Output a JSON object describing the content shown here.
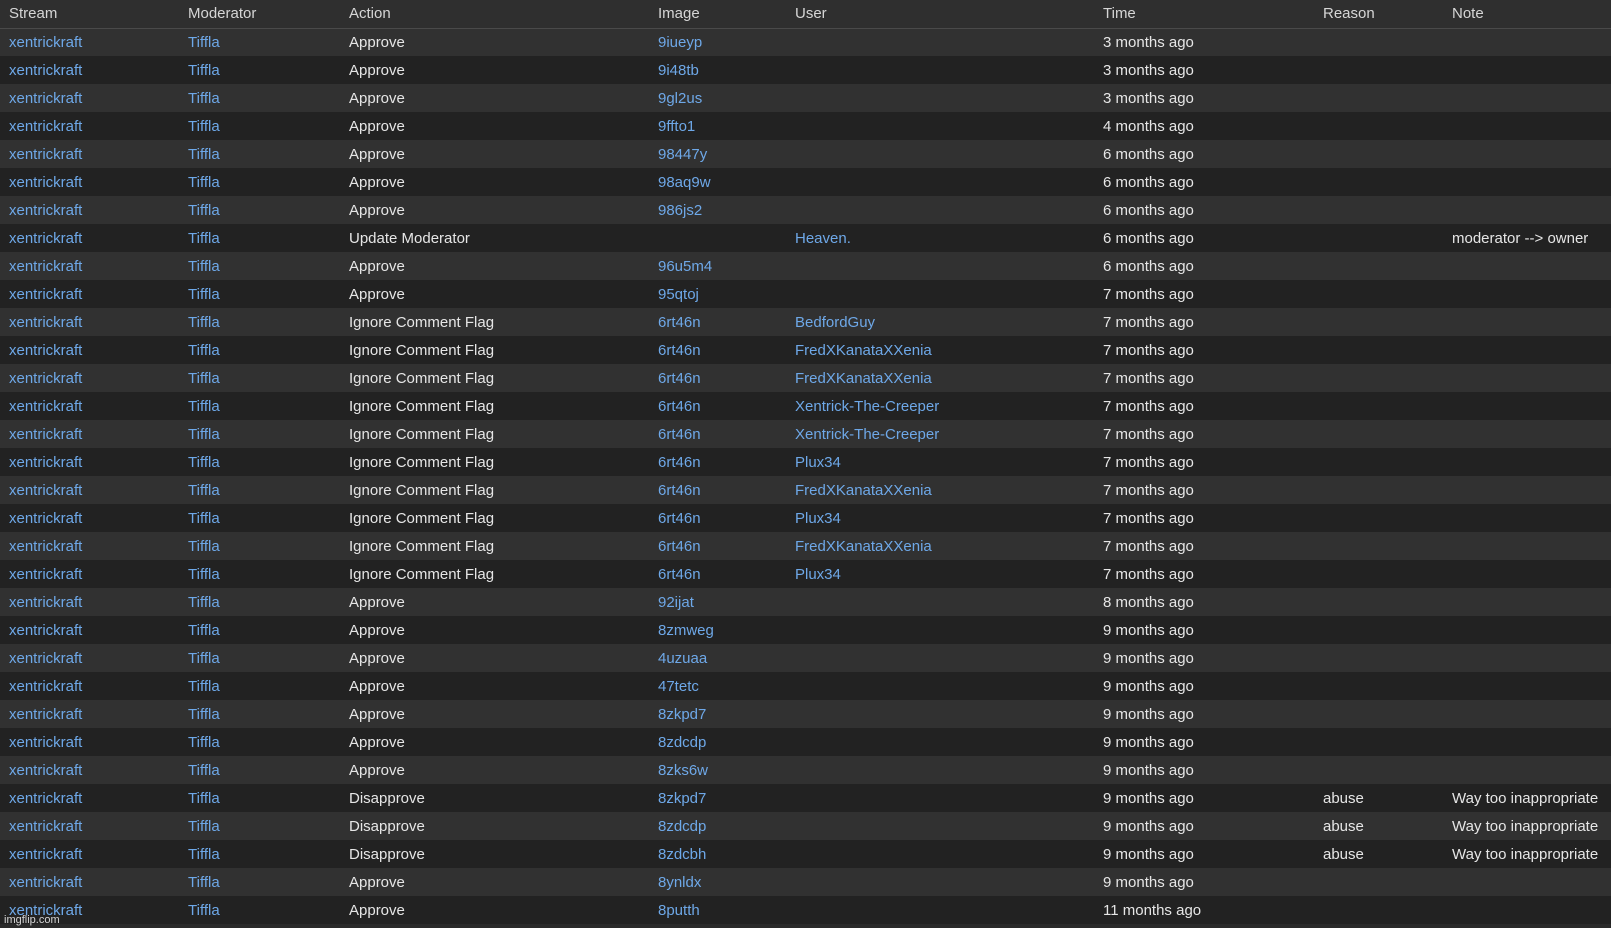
{
  "columns": {
    "stream": "Stream",
    "moderator": "Moderator",
    "action": "Action",
    "image": "Image",
    "user": "User",
    "time": "Time",
    "reason": "Reason",
    "note": "Note"
  },
  "rows": [
    {
      "stream": "xentrickraft",
      "moderator": "Tiffla",
      "action": "Approve",
      "image": "9iueyp",
      "user": "",
      "time": "3 months ago",
      "reason": "",
      "note": ""
    },
    {
      "stream": "xentrickraft",
      "moderator": "Tiffla",
      "action": "Approve",
      "image": "9i48tb",
      "user": "",
      "time": "3 months ago",
      "reason": "",
      "note": ""
    },
    {
      "stream": "xentrickraft",
      "moderator": "Tiffla",
      "action": "Approve",
      "image": "9gl2us",
      "user": "",
      "time": "3 months ago",
      "reason": "",
      "note": ""
    },
    {
      "stream": "xentrickraft",
      "moderator": "Tiffla",
      "action": "Approve",
      "image": "9ffto1",
      "user": "",
      "time": "4 months ago",
      "reason": "",
      "note": ""
    },
    {
      "stream": "xentrickraft",
      "moderator": "Tiffla",
      "action": "Approve",
      "image": "98447y",
      "user": "",
      "time": "6 months ago",
      "reason": "",
      "note": ""
    },
    {
      "stream": "xentrickraft",
      "moderator": "Tiffla",
      "action": "Approve",
      "image": "98aq9w",
      "user": "",
      "time": "6 months ago",
      "reason": "",
      "note": ""
    },
    {
      "stream": "xentrickraft",
      "moderator": "Tiffla",
      "action": "Approve",
      "image": "986js2",
      "user": "",
      "time": "6 months ago",
      "reason": "",
      "note": ""
    },
    {
      "stream": "xentrickraft",
      "moderator": "Tiffla",
      "action": "Update Moderator",
      "image": "",
      "user": "Heaven.",
      "time": "6 months ago",
      "reason": "",
      "note": "moderator --> owner"
    },
    {
      "stream": "xentrickraft",
      "moderator": "Tiffla",
      "action": "Approve",
      "image": "96u5m4",
      "user": "",
      "time": "6 months ago",
      "reason": "",
      "note": ""
    },
    {
      "stream": "xentrickraft",
      "moderator": "Tiffla",
      "action": "Approve",
      "image": "95qtoj",
      "user": "",
      "time": "7 months ago",
      "reason": "",
      "note": ""
    },
    {
      "stream": "xentrickraft",
      "moderator": "Tiffla",
      "action": "Ignore Comment Flag",
      "image": "6rt46n",
      "user": "BedfordGuy",
      "time": "7 months ago",
      "reason": "",
      "note": ""
    },
    {
      "stream": "xentrickraft",
      "moderator": "Tiffla",
      "action": "Ignore Comment Flag",
      "image": "6rt46n",
      "user": "FredXKanataXXenia",
      "time": "7 months ago",
      "reason": "",
      "note": ""
    },
    {
      "stream": "xentrickraft",
      "moderator": "Tiffla",
      "action": "Ignore Comment Flag",
      "image": "6rt46n",
      "user": "FredXKanataXXenia",
      "time": "7 months ago",
      "reason": "",
      "note": ""
    },
    {
      "stream": "xentrickraft",
      "moderator": "Tiffla",
      "action": "Ignore Comment Flag",
      "image": "6rt46n",
      "user": "Xentrick-The-Creeper",
      "time": "7 months ago",
      "reason": "",
      "note": ""
    },
    {
      "stream": "xentrickraft",
      "moderator": "Tiffla",
      "action": "Ignore Comment Flag",
      "image": "6rt46n",
      "user": "Xentrick-The-Creeper",
      "time": "7 months ago",
      "reason": "",
      "note": ""
    },
    {
      "stream": "xentrickraft",
      "moderator": "Tiffla",
      "action": "Ignore Comment Flag",
      "image": "6rt46n",
      "user": "Plux34",
      "time": "7 months ago",
      "reason": "",
      "note": ""
    },
    {
      "stream": "xentrickraft",
      "moderator": "Tiffla",
      "action": "Ignore Comment Flag",
      "image": "6rt46n",
      "user": "FredXKanataXXenia",
      "time": "7 months ago",
      "reason": "",
      "note": ""
    },
    {
      "stream": "xentrickraft",
      "moderator": "Tiffla",
      "action": "Ignore Comment Flag",
      "image": "6rt46n",
      "user": "Plux34",
      "time": "7 months ago",
      "reason": "",
      "note": ""
    },
    {
      "stream": "xentrickraft",
      "moderator": "Tiffla",
      "action": "Ignore Comment Flag",
      "image": "6rt46n",
      "user": "FredXKanataXXenia",
      "time": "7 months ago",
      "reason": "",
      "note": ""
    },
    {
      "stream": "xentrickraft",
      "moderator": "Tiffla",
      "action": "Ignore Comment Flag",
      "image": "6rt46n",
      "user": "Plux34",
      "time": "7 months ago",
      "reason": "",
      "note": ""
    },
    {
      "stream": "xentrickraft",
      "moderator": "Tiffla",
      "action": "Approve",
      "image": "92ijat",
      "user": "",
      "time": "8 months ago",
      "reason": "",
      "note": ""
    },
    {
      "stream": "xentrickraft",
      "moderator": "Tiffla",
      "action": "Approve",
      "image": "8zmweg",
      "user": "",
      "time": "9 months ago",
      "reason": "",
      "note": ""
    },
    {
      "stream": "xentrickraft",
      "moderator": "Tiffla",
      "action": "Approve",
      "image": "4uzuaa",
      "user": "",
      "time": "9 months ago",
      "reason": "",
      "note": ""
    },
    {
      "stream": "xentrickraft",
      "moderator": "Tiffla",
      "action": "Approve",
      "image": "47tetc",
      "user": "",
      "time": "9 months ago",
      "reason": "",
      "note": ""
    },
    {
      "stream": "xentrickraft",
      "moderator": "Tiffla",
      "action": "Approve",
      "image": "8zkpd7",
      "user": "",
      "time": "9 months ago",
      "reason": "",
      "note": ""
    },
    {
      "stream": "xentrickraft",
      "moderator": "Tiffla",
      "action": "Approve",
      "image": "8zdcdp",
      "user": "",
      "time": "9 months ago",
      "reason": "",
      "note": ""
    },
    {
      "stream": "xentrickraft",
      "moderator": "Tiffla",
      "action": "Approve",
      "image": "8zks6w",
      "user": "",
      "time": "9 months ago",
      "reason": "",
      "note": ""
    },
    {
      "stream": "xentrickraft",
      "moderator": "Tiffla",
      "action": "Disapprove",
      "image": "8zkpd7",
      "user": "",
      "time": "9 months ago",
      "reason": "abuse",
      "note": "Way too inappropriate"
    },
    {
      "stream": "xentrickraft",
      "moderator": "Tiffla",
      "action": "Disapprove",
      "image": "8zdcdp",
      "user": "",
      "time": "9 months ago",
      "reason": "abuse",
      "note": "Way too inappropriate"
    },
    {
      "stream": "xentrickraft",
      "moderator": "Tiffla",
      "action": "Disapprove",
      "image": "8zdcbh",
      "user": "",
      "time": "9 months ago",
      "reason": "abuse",
      "note": "Way too inappropriate"
    },
    {
      "stream": "xentrickraft",
      "moderator": "Tiffla",
      "action": "Approve",
      "image": "8ynldx",
      "user": "",
      "time": "9 months ago",
      "reason": "",
      "note": ""
    },
    {
      "stream": "xentrickraft",
      "moderator": "Tiffla",
      "action": "Approve",
      "image": "8putth",
      "user": "",
      "time": "11 months ago",
      "reason": "",
      "note": ""
    }
  ],
  "watermark": "imgflip.com",
  "colors": {
    "background": "#2a2a2a",
    "row_odd": "#313131",
    "row_even": "#222222",
    "link": "#6ea8e8",
    "text": "#e6e6e6"
  }
}
